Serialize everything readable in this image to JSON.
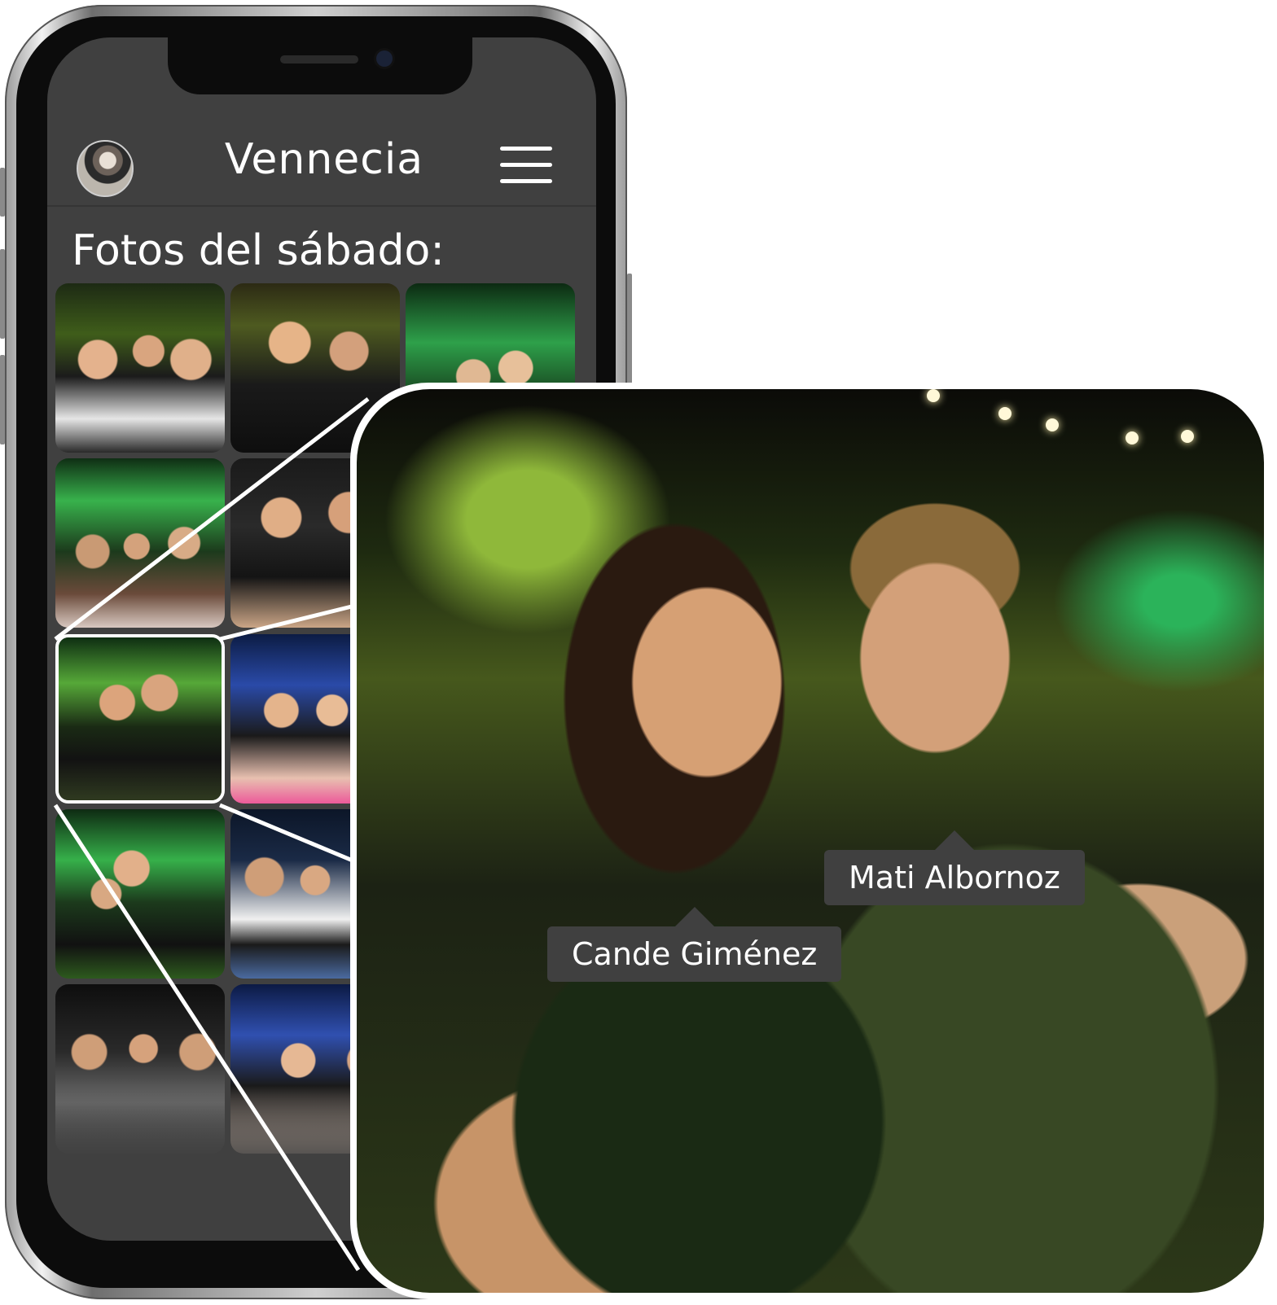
{
  "app": {
    "title": "Vennecia",
    "avatar_icon": "user-avatar",
    "menu_icon": "hamburger-menu-icon"
  },
  "gallery": {
    "heading": "Fotos del sábado:",
    "photos": [
      {
        "id": "photo-1"
      },
      {
        "id": "photo-2"
      },
      {
        "id": "photo-3"
      },
      {
        "id": "photo-4"
      },
      {
        "id": "photo-5"
      },
      {
        "id": "photo-6",
        "selected": true
      },
      {
        "id": "photo-7"
      },
      {
        "id": "photo-8"
      },
      {
        "id": "photo-9"
      },
      {
        "id": "photo-10"
      },
      {
        "id": "photo-11"
      }
    ]
  },
  "zoom": {
    "tags": [
      {
        "name": "Mati Albornoz"
      },
      {
        "name": "Cande Giménez"
      }
    ]
  },
  "colors": {
    "screen_bg": "#404040",
    "tag_bg": "#404040",
    "text": "#ffffff"
  }
}
